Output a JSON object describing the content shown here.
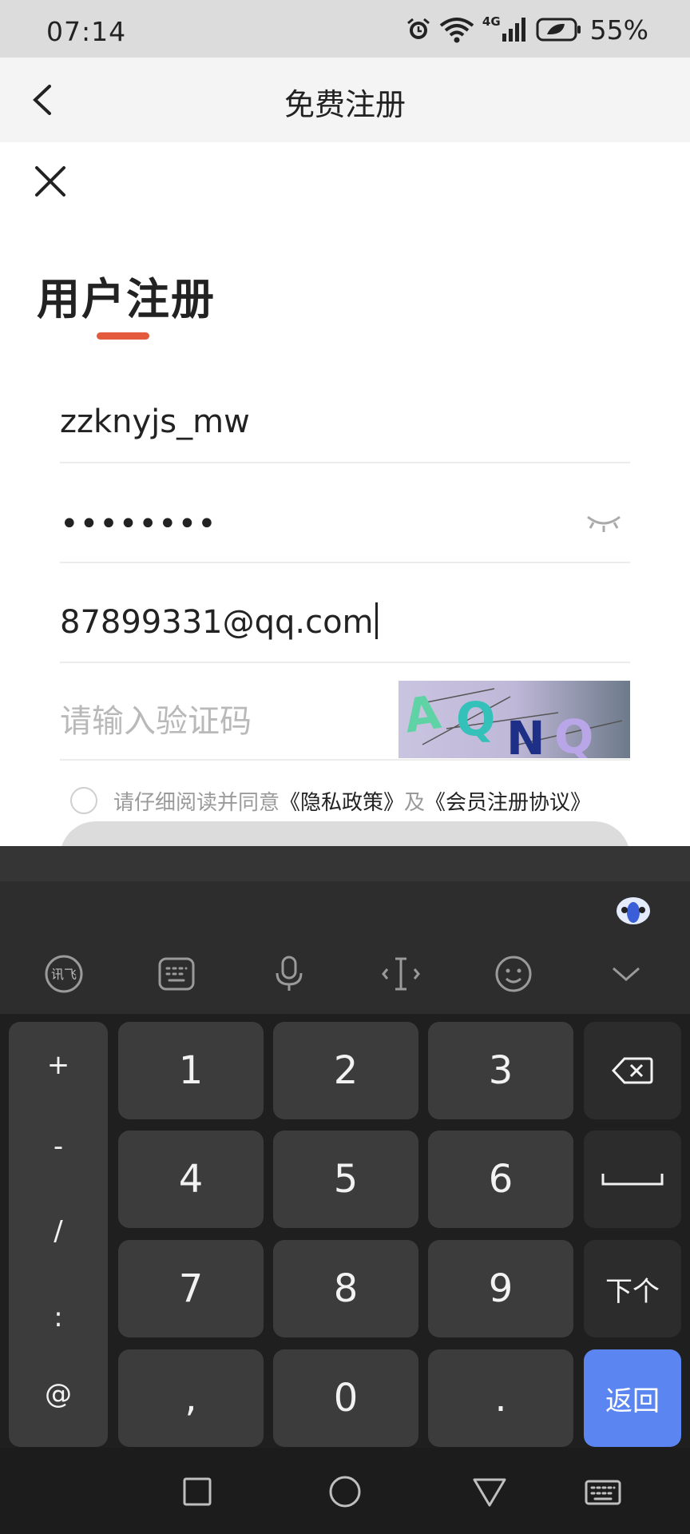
{
  "status": {
    "time": "07:14",
    "network": "4G",
    "battery": "55%"
  },
  "nav": {
    "title": "免费注册"
  },
  "form": {
    "title": "用户注册",
    "username": "zzknyjs_mw",
    "password_masked": "••••••••",
    "email": "87899331@qq.com",
    "captcha_placeholder": "请输入验证码",
    "captcha_text": "AQNQ",
    "agree_prefix": "请仔细阅读并同意",
    "privacy_link": "《隐私政策》",
    "agree_and": "及",
    "member_link": "《会员注册协议》"
  },
  "keyboard": {
    "symbols": [
      "+",
      "-",
      "/",
      ":",
      "@"
    ],
    "digits": [
      "1",
      "2",
      "3",
      "4",
      "5",
      "6",
      "7",
      "8",
      "9"
    ],
    "comma": ",",
    "zero": "0",
    "dot": ".",
    "next_label": "下个",
    "return_label": "返回",
    "accent": "#5b86f2"
  }
}
